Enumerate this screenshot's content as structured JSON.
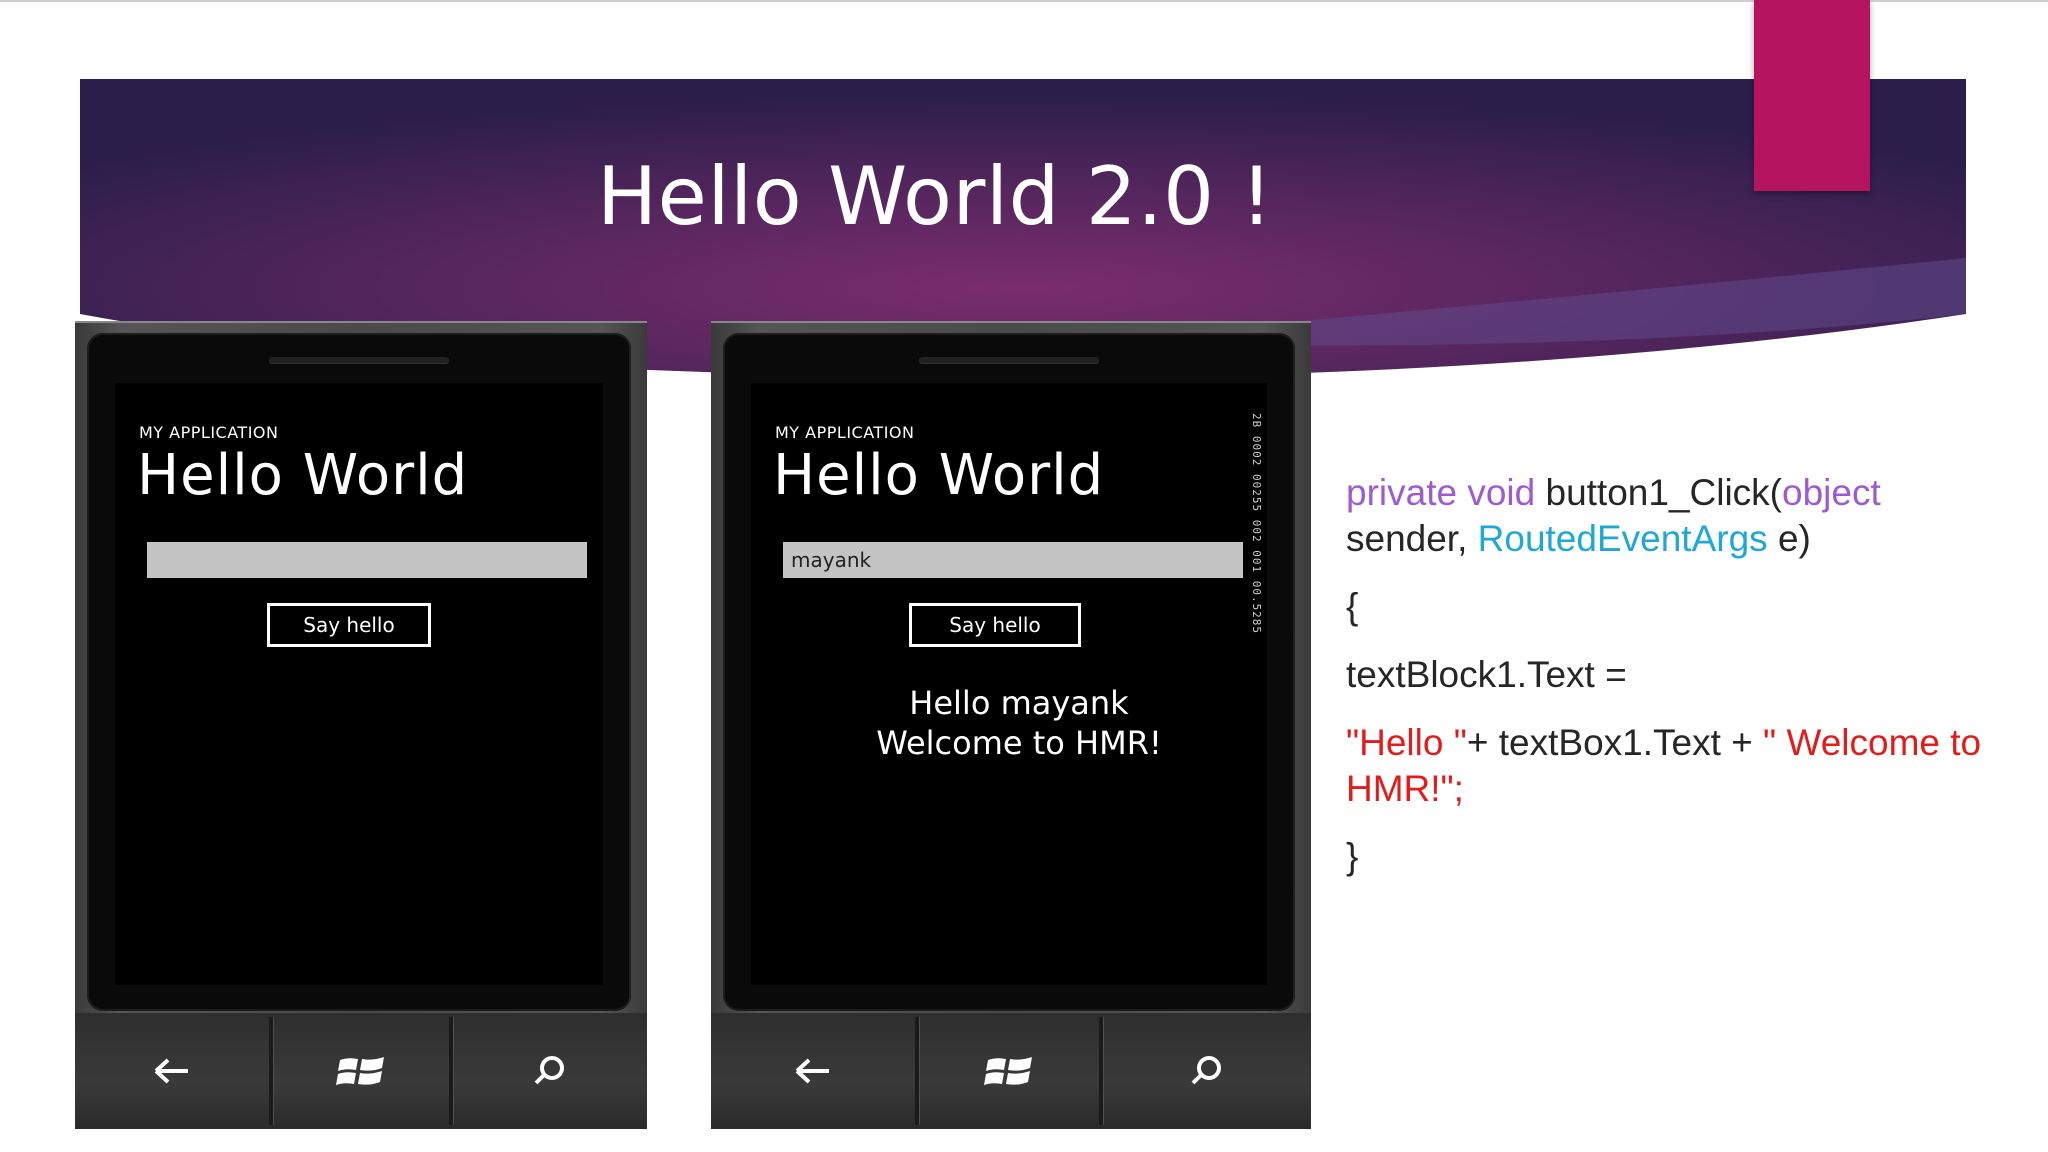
{
  "slide": {
    "title": "Hello World 2.0 !",
    "colors": {
      "banner_dark": "#2a1e4a",
      "banner_mid": "#6b2d66",
      "accent": "#b5145e",
      "keyword": "#9d5bd2",
      "type": "#1fa7d6",
      "string": "#e41b1b"
    }
  },
  "phone_left": {
    "app_label": "MY APPLICATION",
    "heading": "Hello World",
    "textbox_value": "",
    "button_label": "Say hello",
    "result_line1": "",
    "result_line2": "",
    "nav": [
      "back-icon",
      "windows-icon",
      "search-icon"
    ]
  },
  "phone_right": {
    "app_label": "MY APPLICATION",
    "heading": "Hello World",
    "textbox_value": "mayank",
    "button_label": "Say hello",
    "result_line1": "Hello mayank",
    "result_line2": "Welcome to HMR!",
    "frame_counter": "2B 0002 00255 002 001 00.5285",
    "nav": [
      "back-icon",
      "windows-icon",
      "search-icon"
    ]
  },
  "code": {
    "line1_kw": "private void",
    "line1_name": " button1_Click(",
    "line1_type_obj": "object",
    "line1_sender": "sender, ",
    "line1_type_args": "RoutedEventArgs",
    "line1_tail": " e)",
    "open_brace": "{",
    "assign": " textBlock1.Text =",
    "str_hello": "\"Hello \"",
    "concat": "+ textBox1.Text + ",
    "str_welcome": "\" Welcome to HMR!\";",
    "close_brace": "}"
  }
}
